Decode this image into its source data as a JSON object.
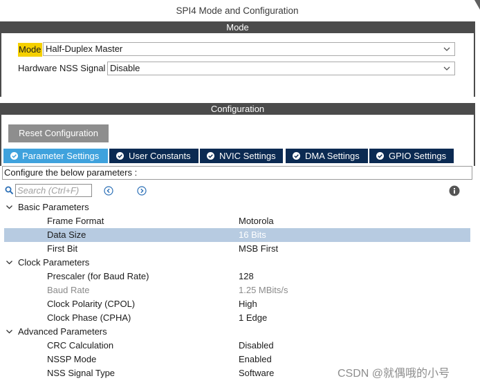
{
  "window": {
    "title": "SPI4 Mode and Configuration"
  },
  "mode_section": {
    "header": "Mode",
    "mode": {
      "label": "Mode",
      "value": "Half-Duplex Master"
    },
    "nss": {
      "label": "Hardware NSS Signal",
      "value": "Disable"
    }
  },
  "config_section": {
    "header": "Configuration",
    "reset_label": "Reset Configuration",
    "tabs": [
      {
        "label": "Parameter Settings",
        "active": true
      },
      {
        "label": "User Constants",
        "active": false
      },
      {
        "label": "NVIC Settings",
        "active": false
      },
      {
        "label": "DMA Settings",
        "active": false
      },
      {
        "label": "GPIO Settings",
        "active": false
      }
    ],
    "configure_text": "Configure the below parameters :",
    "search_placeholder": "Search (Ctrl+F)",
    "groups": [
      {
        "name": "Basic Parameters",
        "params": [
          {
            "name": "Frame Format",
            "value": "Motorola"
          },
          {
            "name": "Data Size",
            "value": "16 Bits",
            "selected": true
          },
          {
            "name": "First Bit",
            "value": "MSB First"
          }
        ]
      },
      {
        "name": "Clock Parameters",
        "params": [
          {
            "name": "Prescaler (for Baud Rate)",
            "value": "128"
          },
          {
            "name": "Baud Rate",
            "value": "1.25 MBits/s",
            "disabled": true
          },
          {
            "name": "Clock Polarity (CPOL)",
            "value": "High"
          },
          {
            "name": "Clock Phase (CPHA)",
            "value": "1 Edge"
          }
        ]
      },
      {
        "name": "Advanced Parameters",
        "params": [
          {
            "name": "CRC Calculation",
            "value": "Disabled"
          },
          {
            "name": "NSSP Mode",
            "value": "Enabled"
          },
          {
            "name": "NSS Signal Type",
            "value": "Software"
          }
        ]
      }
    ]
  },
  "watermark": "CSDN @就偶哦的小号",
  "colors": {
    "header_bar": "#4b4b4b",
    "tab_active": "#3fa2dd",
    "tab_inactive": "#0b2a52",
    "highlight": "#f5d000",
    "selected_row": "#b7cbe1"
  },
  "icons": [
    "search-icon",
    "prev-icon",
    "next-icon",
    "info-icon",
    "check-icon",
    "chevron-down-icon",
    "collapse-icon"
  ]
}
